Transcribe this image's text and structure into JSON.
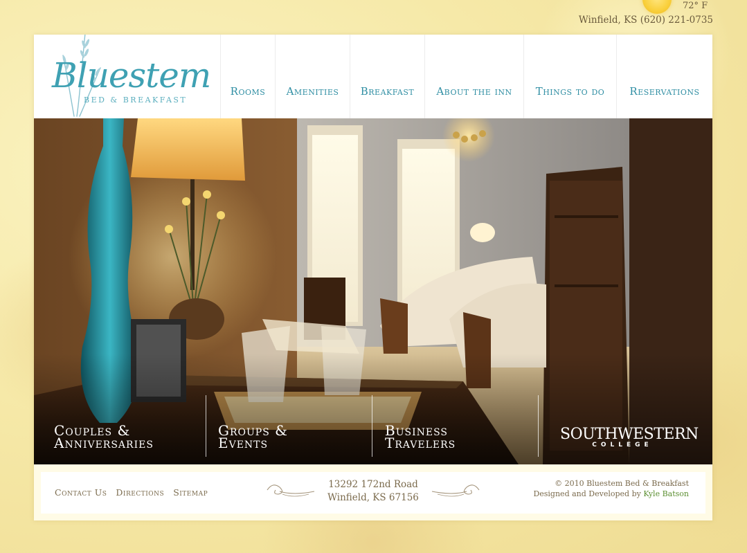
{
  "top_bar": {
    "temperature": "72° F",
    "location_phone": "Winfield, KS (620) 221-0735"
  },
  "logo": {
    "name": "Bluestem",
    "subtitle": "BED & BREAKFAST"
  },
  "nav": {
    "items": [
      {
        "label": "Rooms"
      },
      {
        "label": "Amenities"
      },
      {
        "label": "Breakfast"
      },
      {
        "label": "About the inn"
      },
      {
        "label": "Things to do"
      },
      {
        "label": "Reservations"
      }
    ]
  },
  "hero": {
    "links": [
      {
        "line1": "Couples &",
        "line2": "Anniversaries"
      },
      {
        "line1": "Groups &",
        "line2": "Events"
      },
      {
        "line1": "Business",
        "line2": "Travelers"
      }
    ],
    "partner": {
      "name": "SOUTHWESTERN",
      "sub": "COLLEGE"
    }
  },
  "footer": {
    "links": [
      "Contact Us",
      "Directions",
      "Sitemap"
    ],
    "address_line1": "13292 172nd Road",
    "address_line2": "Winfield, KS 67156",
    "copyright": "© 2010 Bluestem Bed & Breakfast",
    "credit_prefix": "Designed and Developed by ",
    "credit_name": "Kyle Batson"
  },
  "colors": {
    "accent": "#2f8ea3",
    "footer_text": "#7a6a4c",
    "credit_link": "#5c8f32",
    "background": "#f6e9a8"
  }
}
